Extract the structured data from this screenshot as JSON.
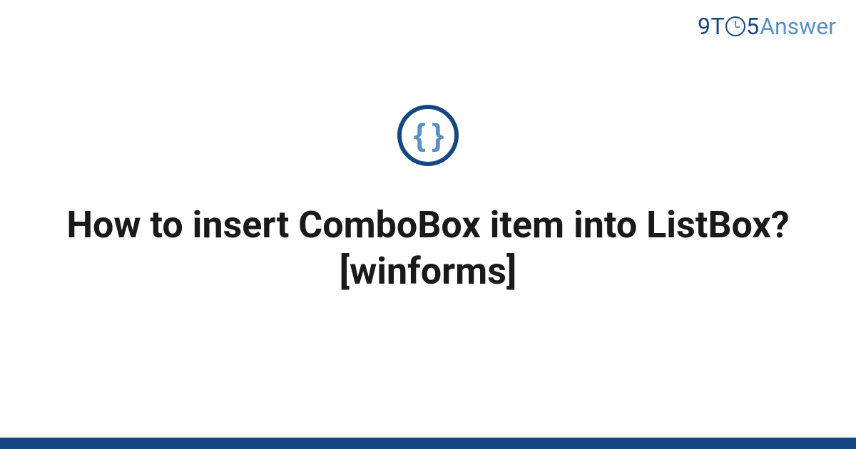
{
  "logo": {
    "part1": "9T",
    "part2": "5",
    "part3": "Answer"
  },
  "icon": {
    "braces": "{ }",
    "name": "code-braces-icon"
  },
  "title": "How to insert ComboBox item into ListBox? [winforms]",
  "colors": {
    "primary": "#154880",
    "secondary": "#5a8fc7",
    "text": "#1a1a1a"
  }
}
